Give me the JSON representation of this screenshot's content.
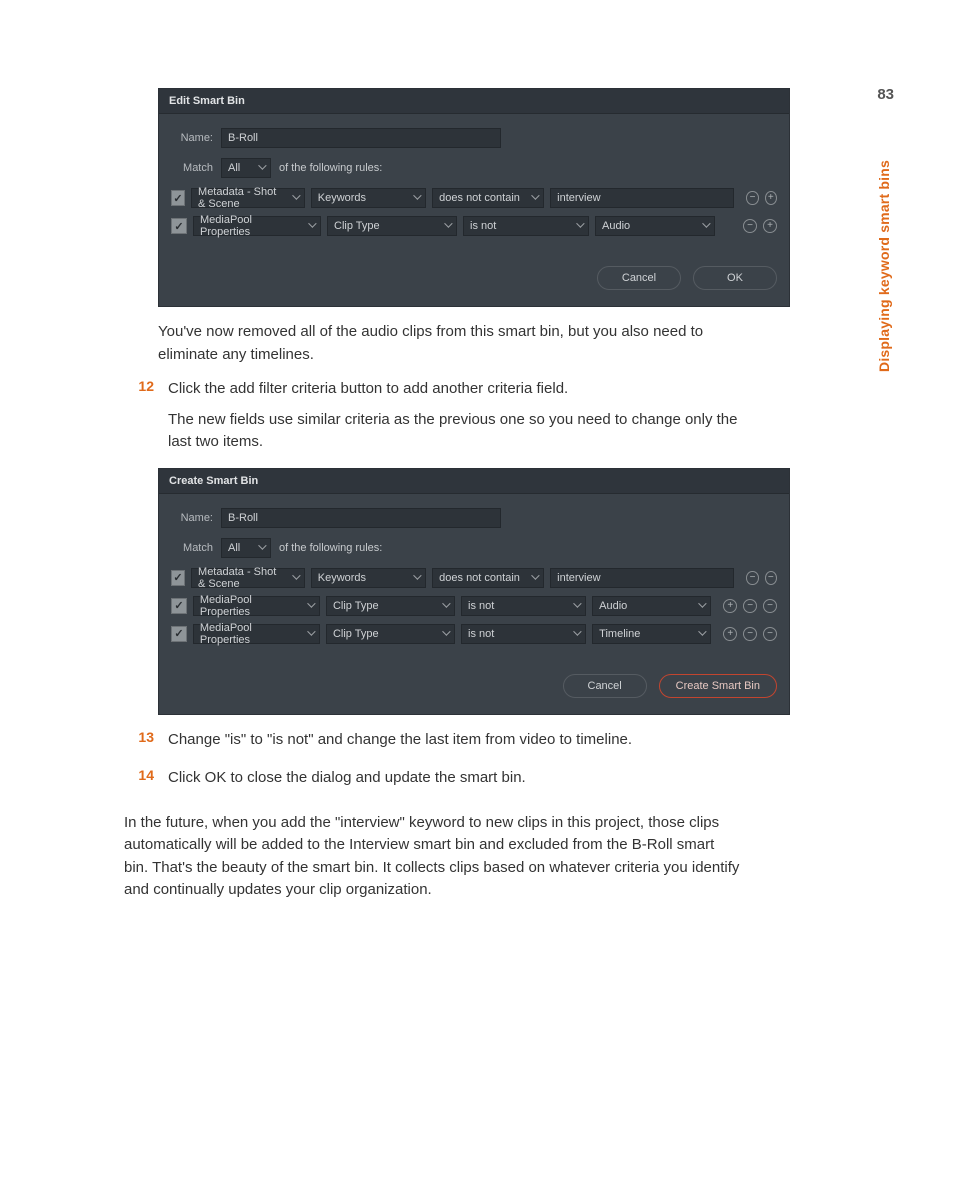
{
  "page_number": "83",
  "side_label": "Displaying keyword smart bins",
  "dialog1": {
    "title": "Edit Smart Bin",
    "name_label": "Name:",
    "name_value": "B-Roll",
    "match_label": "Match",
    "match_value": "All",
    "match_suffix": "of the following rules:",
    "rules": [
      {
        "c1": "Metadata - Shot & Scene",
        "c2": "Keywords",
        "c3": "does not contain",
        "c4_type": "text",
        "c4": "interview",
        "buttons": [
          "minus",
          "plus"
        ]
      },
      {
        "c1": "MediaPool Properties",
        "c2": "Clip Type",
        "c3": "is not",
        "c4_type": "select",
        "c4": "Audio",
        "buttons": [
          "minus",
          "plus"
        ]
      }
    ],
    "cancel": "Cancel",
    "ok": "OK"
  },
  "text_after_d1": "You've now removed all of the audio clips from this smart bin, but you also need to eliminate any timelines.",
  "step12": {
    "num": "12",
    "line1": "Click the add filter criteria button to add another criteria field.",
    "line2": "The new fields use similar criteria as the previous one so you need to change only the last two items."
  },
  "dialog2": {
    "title": "Create Smart Bin",
    "name_label": "Name:",
    "name_value": "B-Roll",
    "match_label": "Match",
    "match_value": "All",
    "match_suffix": "of the following rules:",
    "rules": [
      {
        "c1": "Metadata - Shot & Scene",
        "c2": "Keywords",
        "c3": "does not contain",
        "c4_type": "text",
        "c4": "interview",
        "buttons": [
          "minus",
          "minus2"
        ]
      },
      {
        "c1": "MediaPool Properties",
        "c2": "Clip Type",
        "c3": "is not",
        "c4_type": "select",
        "c4": "Audio",
        "buttons": [
          "plus",
          "minus",
          "minus2"
        ]
      },
      {
        "c1": "MediaPool Properties",
        "c2": "Clip Type",
        "c3": "is not",
        "c4_type": "select",
        "c4": "Timeline",
        "buttons": [
          "plus",
          "minus",
          "minus2"
        ]
      }
    ],
    "cancel": "Cancel",
    "ok": "Create Smart Bin"
  },
  "step13": {
    "num": "13",
    "line1": "Change \"is\" to \"is not\" and change the last item from video to timeline."
  },
  "step14": {
    "num": "14",
    "line1": "Click OK to close the dialog and update the smart bin."
  },
  "closing": "In the future, when you add the \"interview\" keyword to new clips in this project, those clips automatically will be added to the Interview smart bin and excluded from the B-Roll smart bin. That's the beauty of the smart bin. It collects clips based on whatever criteria you identify and continually updates your clip organization.",
  "glyph": {
    "check": "✓",
    "minus": "−",
    "plus": "+"
  }
}
